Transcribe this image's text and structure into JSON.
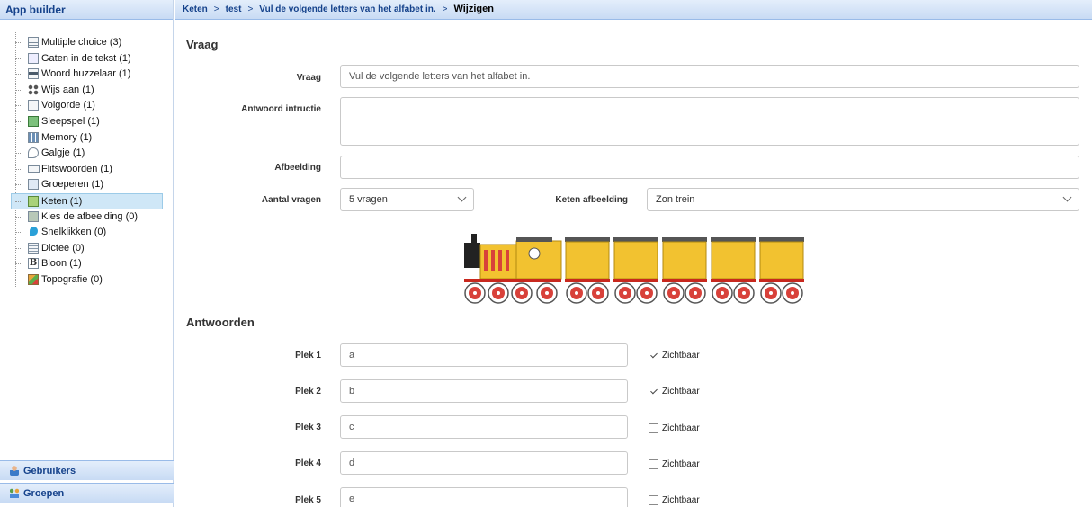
{
  "sidebar": {
    "title": "App builder",
    "items": [
      {
        "label": "Multiple choice (3)",
        "icon": "multiple-choice-icon"
      },
      {
        "label": "Gaten in de tekst (1)",
        "icon": "gaten-icon"
      },
      {
        "label": "Woord huzzelaar (1)",
        "icon": "woord-icon"
      },
      {
        "label": "Wijs aan (1)",
        "icon": "wijs-aan-icon"
      },
      {
        "label": "Volgorde (1)",
        "icon": "volgorde-icon"
      },
      {
        "label": "Sleepspel (1)",
        "icon": "sleepspel-icon"
      },
      {
        "label": "Memory (1)",
        "icon": "memory-icon"
      },
      {
        "label": "Galgje (1)",
        "icon": "galgje-icon"
      },
      {
        "label": "Flitswoorden (1)",
        "icon": "flitswoorden-icon"
      },
      {
        "label": "Groeperen (1)",
        "icon": "groeperen-icon"
      },
      {
        "label": "Keten (1)",
        "icon": "keten-icon",
        "selected": true
      },
      {
        "label": "Kies de afbeelding (0)",
        "icon": "kies-afbeelding-icon"
      },
      {
        "label": "Snelklikken (0)",
        "icon": "snelklikken-icon"
      },
      {
        "label": "Dictee (0)",
        "icon": "dictee-icon"
      },
      {
        "label": "Bloon (1)",
        "icon": "bloon-icon"
      },
      {
        "label": "Topografie (0)",
        "icon": "topografie-icon"
      }
    ],
    "bottom": {
      "users": "Gebruikers",
      "groups": "Groepen"
    }
  },
  "breadcrumb": {
    "items": [
      "Keten",
      "test",
      "Vul de volgende letters van het alfabet in."
    ],
    "current": "Wijzigen",
    "separator": ">"
  },
  "form": {
    "section_vraag": "Vraag",
    "vraag_label": "Vraag",
    "vraag_value": "Vul de volgende letters van het alfabet in.",
    "instructie_label": "Antwoord intructie",
    "instructie_value": "",
    "afbeelding_label": "Afbeelding",
    "afbeelding_value": "",
    "aantal_label": "Aantal vragen",
    "aantal_value": "5 vragen",
    "keten_label": "Keten afbeelding",
    "keten_value": "Zon trein"
  },
  "train": {
    "wagons": 5,
    "colors": {
      "body": "#f2c230",
      "roof": "#555555",
      "wheel": "#d8413a",
      "chassis": "#c8281e",
      "cab": "#222222"
    }
  },
  "answers": {
    "section_title": "Antwoorden",
    "visible_label": "Zichtbaar",
    "rows": [
      {
        "label": "Plek 1",
        "value": "a",
        "visible": true
      },
      {
        "label": "Plek 2",
        "value": "b",
        "visible": true
      },
      {
        "label": "Plek 3",
        "value": "c",
        "visible": false
      },
      {
        "label": "Plek 4",
        "value": "d",
        "visible": false
      },
      {
        "label": "Plek 5",
        "value": "e",
        "visible": false
      }
    ]
  }
}
